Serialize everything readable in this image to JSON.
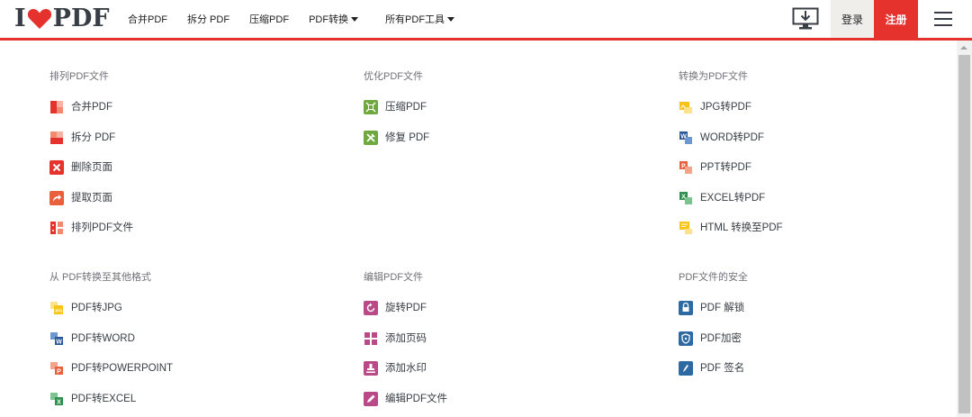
{
  "header": {
    "logo": {
      "left": "I",
      "right": "PDF"
    },
    "nav": [
      {
        "label": "合并PDF",
        "dropdown": false
      },
      {
        "label": "拆分 PDF",
        "dropdown": false
      },
      {
        "label": "压缩PDF",
        "dropdown": false
      },
      {
        "label": "PDF转换",
        "dropdown": true
      },
      {
        "label": "所有PDF工具",
        "dropdown": true
      }
    ],
    "login": "登录",
    "signup": "注册",
    "desktop_icon": "desktop-download-icon",
    "menu_icon": "hamburger-menu-icon"
  },
  "colors": {
    "brand_red": "#e5322d",
    "text": "#383e45",
    "section_title": "#707078"
  },
  "sections": [
    {
      "title": "排列PDF文件",
      "tools": [
        {
          "label": "合并PDF",
          "icon": "merge-icon",
          "color": "#e5322d"
        },
        {
          "label": "拆分 PDF",
          "icon": "split-icon",
          "color": "#e5322d"
        },
        {
          "label": "删除页面",
          "icon": "delete-pages-icon",
          "color": "#e5322d"
        },
        {
          "label": "提取页面",
          "icon": "extract-pages-icon",
          "color": "#e5322d"
        },
        {
          "label": "排列PDF文件",
          "icon": "organize-icon",
          "color": "#e5322d"
        }
      ]
    },
    {
      "title": "优化PDF文件",
      "tools": [
        {
          "label": "压缩PDF",
          "icon": "compress-icon",
          "color": "#6ea83e"
        },
        {
          "label": "修复 PDF",
          "icon": "repair-icon",
          "color": "#6ea83e"
        }
      ]
    },
    {
      "title": "转换为PDF文件",
      "tools": [
        {
          "label": "JPG转PDF",
          "icon": "jpg-to-pdf-icon",
          "color": "#f7c417"
        },
        {
          "label": "WORD转PDF",
          "icon": "word-to-pdf-icon",
          "color": "#2b5797"
        },
        {
          "label": "PPT转PDF",
          "icon": "ppt-to-pdf-icon",
          "color": "#e8613c"
        },
        {
          "label": "EXCEL转PDF",
          "icon": "excel-to-pdf-icon",
          "color": "#2f8f4e"
        },
        {
          "label": "HTML 转换至PDF",
          "icon": "html-to-pdf-icon",
          "color": "#f7c417"
        }
      ]
    },
    {
      "title": "从 PDF转换至其他格式",
      "tools": [
        {
          "label": "PDF转JPG",
          "icon": "pdf-to-jpg-icon",
          "color": "#f7c417"
        },
        {
          "label": "PDF转WORD",
          "icon": "pdf-to-word-icon",
          "color": "#2b5797"
        },
        {
          "label": "PDF转POWERPOINT",
          "icon": "pdf-to-powerpoint-icon",
          "color": "#e8613c"
        },
        {
          "label": "PDF转EXCEL",
          "icon": "pdf-to-excel-icon",
          "color": "#2f8f4e"
        }
      ]
    },
    {
      "title": "编辑PDF文件",
      "tools": [
        {
          "label": "旋转PDF",
          "icon": "rotate-icon",
          "color": "#b94a87"
        },
        {
          "label": "添加页码",
          "icon": "page-numbers-icon",
          "color": "#b94a87"
        },
        {
          "label": "添加水印",
          "icon": "watermark-icon",
          "color": "#b94a87"
        },
        {
          "label": "编辑PDF文件",
          "icon": "edit-pdf-icon",
          "color": "#b94a87"
        }
      ]
    },
    {
      "title": "PDF文件的安全",
      "tools": [
        {
          "label": "PDF 解锁",
          "icon": "unlock-icon",
          "color": "#2d6aa3"
        },
        {
          "label": "PDF加密",
          "icon": "protect-icon",
          "color": "#2d6aa3"
        },
        {
          "label": "PDF 签名",
          "icon": "sign-icon",
          "color": "#2d6aa3"
        }
      ]
    }
  ]
}
